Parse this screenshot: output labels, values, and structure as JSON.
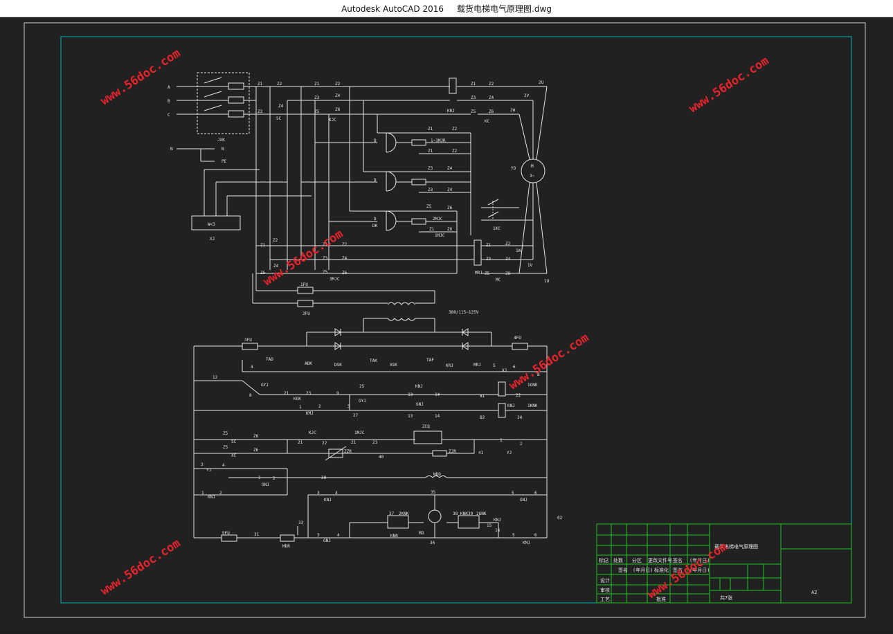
{
  "window": {
    "title": "Autodesk AutoCAD 2016     载货电梯电气原理图.dwg"
  },
  "colors": {
    "background": "#212121",
    "frame": "#d0d0d0",
    "inner_frame": "#00b5b5",
    "wire": "#e6e6e6",
    "title_block": "#19c51e",
    "watermark": "#e8232c"
  },
  "watermark": {
    "text": "www.56doc.com"
  },
  "power": {
    "phases": [
      "A",
      "B",
      "C"
    ],
    "neutral": "N",
    "neutral_out": "N",
    "pe": "PE",
    "main_switch": "JXK",
    "socket": "W<3",
    "socket_label": "XJ"
  },
  "contactors": {
    "sc": "SC",
    "kjc": "KJC",
    "krj": "KRJ",
    "kc": "KC",
    "mrj": "MRJ",
    "mc": "MC",
    "qk": "1KC",
    "mjc": "3MJC"
  },
  "motor": {
    "label": "YD",
    "symbol": "M",
    "phase": "3~",
    "terminals": [
      "2U",
      "2V",
      "2W",
      "1W",
      "1V",
      "1U"
    ]
  },
  "terminal_labels": [
    "Z1",
    "Z2",
    "Z3",
    "Z4",
    "Z5",
    "Z6"
  ],
  "resistors": {
    "r1": "1~3MJR",
    "r2": "2MJC",
    "r3": "1MJC",
    "dk": "DK",
    "d": "D"
  },
  "fuses": [
    "1FU",
    "2FU",
    "3FU",
    "4FU",
    "5FU"
  ],
  "transformer": "380/115~125V",
  "control": {
    "row1": [
      "TAD",
      "ADK",
      "DSK",
      "TAK",
      "XSK",
      "TAF",
      "KRJ",
      "MRJ",
      "XJ",
      "4",
      "5",
      "6",
      "B"
    ],
    "row2": [
      "GYJ",
      "12",
      "8",
      "21",
      "KGK",
      "23",
      "9",
      "25",
      "GYJ",
      "KNJ",
      "13",
      "14",
      "B1",
      "22",
      "1GNK"
    ],
    "row3": [
      "1",
      "2",
      "KMJ",
      "5",
      "27",
      "GNJ",
      "13",
      "14",
      "B2",
      "KNJ",
      "1KNK",
      "24"
    ],
    "row4": [
      "Z5",
      "SC",
      "Z6",
      "Z5",
      "XC",
      "Z6",
      "KJC",
      "1MJC",
      "21",
      "22",
      "21",
      "23",
      "ZZR",
      "ZCQ",
      "ZJR",
      "40",
      "41",
      "1",
      "2",
      "YJ"
    ],
    "row5": [
      "3",
      "YJ",
      "4",
      "1",
      "GNJ",
      "2",
      "30",
      "WDQ",
      "1",
      "KNJ",
      "2"
    ],
    "row6": [
      "3",
      "KNJ",
      "4",
      "35",
      "5",
      "GNJ",
      "6",
      "37",
      "2KNK",
      "38",
      "KNK",
      "39",
      "2GNK",
      "15",
      "KNJ",
      "16",
      "KNR",
      "MD",
      "36",
      "02"
    ],
    "row7": [
      "5FU",
      "31",
      "MDR",
      "33",
      "3",
      "GNJ",
      "4",
      "5",
      "KMJ",
      "6"
    ]
  },
  "title_block": {
    "headers": [
      "标记",
      "处数",
      "分区",
      "更改文件号",
      "签名",
      "(年月日)"
    ],
    "row2": [
      "签名",
      "(年月日)",
      "标准化",
      "签名",
      "(年月日)"
    ],
    "roles": [
      "设计",
      "审核",
      "工艺",
      "批准"
    ],
    "drawing_name": "载货电梯电气原理图",
    "sheets": "共7张",
    "size": "A2"
  }
}
